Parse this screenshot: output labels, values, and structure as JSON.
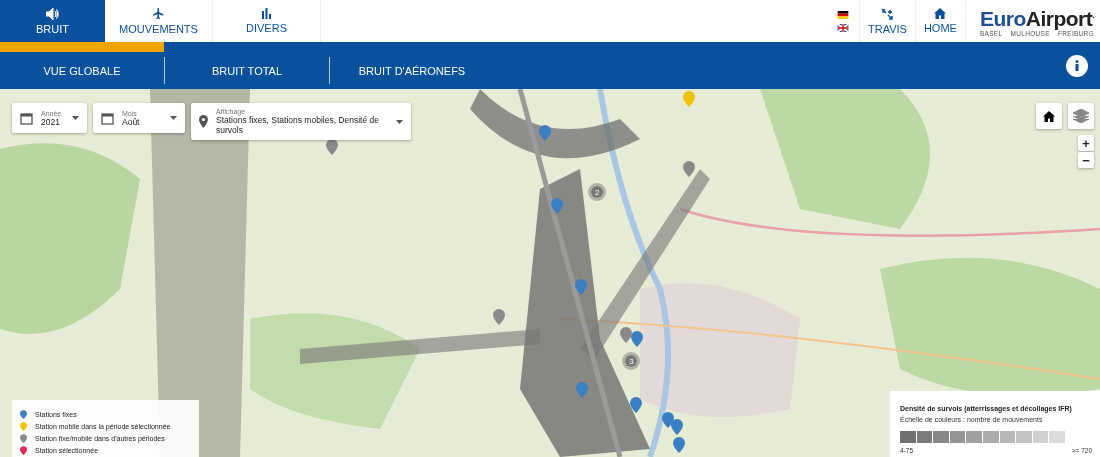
{
  "top_tabs": [
    {
      "label": "BRUIT",
      "selected": true
    },
    {
      "label": "MOUVEMENTS",
      "selected": false
    },
    {
      "label": "DIVERS",
      "selected": false
    }
  ],
  "languages": [
    {
      "kind": "de"
    },
    {
      "kind": "en"
    }
  ],
  "right_links": [
    {
      "label": "TRAVIS"
    },
    {
      "label": "HOME"
    }
  ],
  "logo": {
    "brand_a": "Euro",
    "brand_b": "Airport",
    "mark": ".",
    "cities": [
      "BASEL",
      "MULHOUSE",
      "FREIBURG"
    ]
  },
  "sub_tabs": [
    {
      "label": "VUE GLOBALE",
      "selected": true
    },
    {
      "label": "BRUIT TOTAL",
      "selected": false
    },
    {
      "label": "BRUIT D'AÉRONEFS",
      "selected": false
    }
  ],
  "filters": [
    {
      "label": "Année",
      "value": "2021"
    },
    {
      "label": "Mois",
      "value": "Août"
    },
    {
      "label": "Affichage",
      "value": "Stations fixes, Stations mobiles, Densité de survols"
    }
  ],
  "map": {
    "kind": "picture",
    "zoom_in": "+",
    "zoom_out": "−",
    "pins": [
      {
        "color": "#3a7fc4"
      },
      {
        "color": "#f2c300"
      },
      {
        "color": "#8a8a8a"
      },
      {
        "color": "#8a8a8a"
      },
      {
        "color": "#3a7fc4"
      },
      {
        "color": "#3a7fc4"
      },
      {
        "color": "#8a8a8a"
      },
      {
        "color": "#3a7fc4"
      },
      {
        "color": "#8a8a8a"
      },
      {
        "color": "#3a7fc4"
      },
      {
        "color": "#3a7fc4"
      },
      {
        "color": "#3a7fc4"
      },
      {
        "color": "#3a7fc4"
      },
      {
        "color": "#3a7fc4"
      }
    ],
    "clusters": [
      {
        "count": "2"
      },
      {
        "count": "3"
      }
    ]
  },
  "legend": [
    {
      "label": "Stations fixes",
      "color": "#3a7fc4"
    },
    {
      "label": "Station mobile dans la période sélectionnée",
      "color": "#f2c300"
    },
    {
      "label": "Station fixe/mobile dans d'autres périodes",
      "color": "#8a8a8a"
    },
    {
      "label": "Station sélectionnée",
      "color": "#e8265a"
    }
  ],
  "density": {
    "title": "Densité de survols (atterrissages et décollages IFR)",
    "subtitle": "Échelle de couleurs : nombre de mouvements",
    "min": "4-75",
    "max": ">= 720"
  }
}
